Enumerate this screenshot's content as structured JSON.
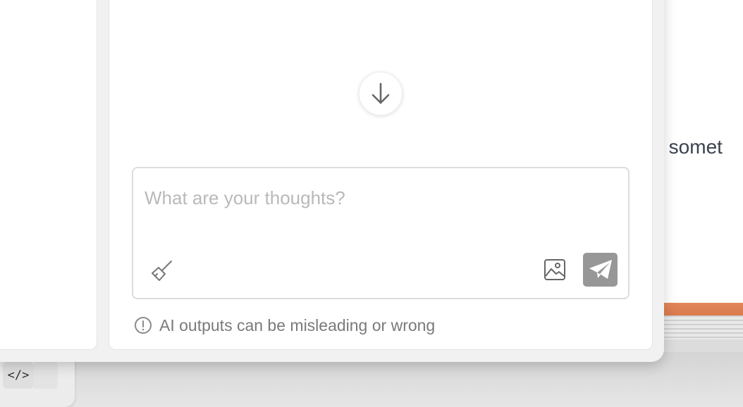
{
  "background": {
    "right_window_text": "re somet",
    "code_button_label": "</>"
  },
  "chat": {
    "scroll_down_icon": "arrow-down-icon",
    "composer": {
      "placeholder": "What are your thoughts?",
      "value": "",
      "clear_icon": "broom-icon",
      "image_icon": "image-icon",
      "send_icon": "send-icon",
      "send_color": "#979797"
    },
    "disclaimer": {
      "icon": "info-circle-icon",
      "text": "AI outputs can be misleading or wrong"
    }
  }
}
